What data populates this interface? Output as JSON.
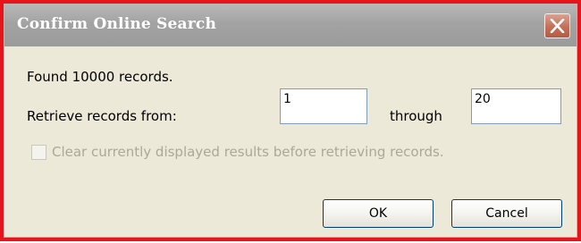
{
  "window": {
    "title": "Confirm Online Search",
    "close_icon": "close-icon",
    "title_color": "#ffffff",
    "frame_highlight_color": "#e8141c"
  },
  "content": {
    "found_text": "Found 10000 records.",
    "retrieve_label": "Retrieve records from:",
    "from_value": "1",
    "through_label": "through",
    "to_value": "20",
    "clear_checkbox": {
      "label": "Clear currently displayed results before retrieving records.",
      "checked": false,
      "enabled": false
    }
  },
  "buttons": {
    "ok_label": "OK",
    "cancel_label": "Cancel"
  }
}
